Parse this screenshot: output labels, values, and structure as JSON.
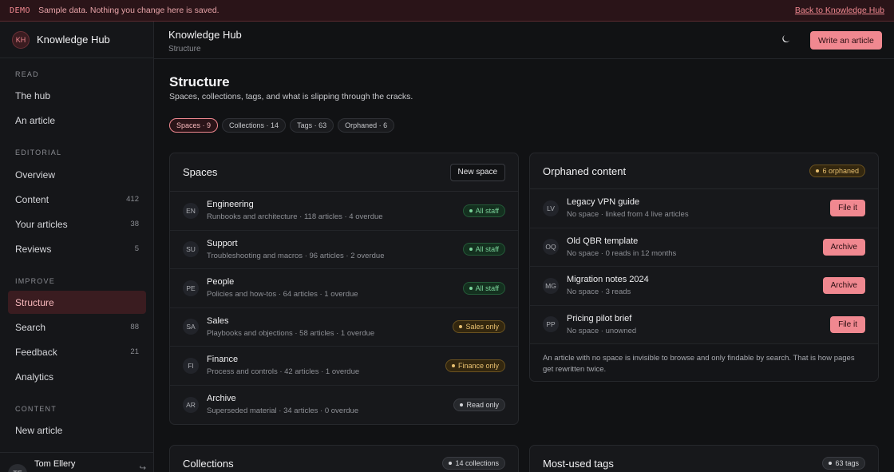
{
  "demo_bar": {
    "tag": "DEMO",
    "text": "Sample data. Nothing you change here is saved.",
    "back_link": "Back to Knowledge Hub"
  },
  "sidebar": {
    "brand_initials": "KH",
    "brand_name": "Knowledge Hub",
    "sections": {
      "read": "READ",
      "editorial": "EDITORIAL",
      "improve": "IMPROVE",
      "content": "CONTENT"
    },
    "items": {
      "the_hub": "The hub",
      "an_article": "An article",
      "overview": "Overview",
      "content": "Content",
      "content_count": "412",
      "your_articles": "Your articles",
      "your_articles_count": "38",
      "reviews": "Reviews",
      "reviews_count": "5",
      "structure": "Structure",
      "search": "Search",
      "search_count": "88",
      "feedback": "Feedback",
      "feedback_count": "21",
      "analytics": "Analytics",
      "new_article": "New article"
    },
    "user": {
      "initials": "TE",
      "name": "Tom Ellery"
    }
  },
  "topbar": {
    "title": "Knowledge Hub",
    "subtitle": "Structure",
    "theme_icon": "moon-icon",
    "write_button": "Write an article"
  },
  "page": {
    "title": "Structure",
    "subtitle": "Spaces, collections, tags, and what is slipping through the cracks."
  },
  "chips": {
    "spaces": "Spaces · 9",
    "collections": "Collections · 14",
    "tags": "Tags · 63",
    "orphaned": "Orphaned · 6"
  },
  "spaces_card": {
    "title": "Spaces",
    "new_button": "New space",
    "rows": [
      {
        "initials": "EN",
        "name": "Engineering",
        "meta": "Runbooks and architecture · 118 articles · 4 overdue",
        "badge": "All staff"
      },
      {
        "initials": "SU",
        "name": "Support",
        "meta": "Troubleshooting and macros · 96 articles · 2 overdue",
        "badge": "All staff"
      },
      {
        "initials": "PE",
        "name": "People",
        "meta": "Policies and how-tos · 64 articles · 1 overdue",
        "badge": "All staff"
      },
      {
        "initials": "SA",
        "name": "Sales",
        "meta": "Playbooks and objections · 58 articles · 1 overdue",
        "badge": "Sales only"
      },
      {
        "initials": "FI",
        "name": "Finance",
        "meta": "Process and controls · 42 articles · 1 overdue",
        "badge": "Finance only"
      },
      {
        "initials": "AR",
        "name": "Archive",
        "meta": "Superseded material · 34 articles · 0 overdue",
        "badge": "Read only"
      }
    ]
  },
  "orphaned_card": {
    "title": "Orphaned content",
    "badge": "6 orphaned",
    "rows": [
      {
        "initials": "LV",
        "name": "Legacy VPN guide",
        "meta": "No space · linked from 4 live articles",
        "action": "File it"
      },
      {
        "initials": "OQ",
        "name": "Old QBR template",
        "meta": "No space · 0 reads in 12 months",
        "action": "Archive"
      },
      {
        "initials": "MG",
        "name": "Migration notes 2024",
        "meta": "No space · 3 reads",
        "action": "Archive"
      },
      {
        "initials": "PP",
        "name": "Pricing pilot brief",
        "meta": "No space · unowned",
        "action": "File it"
      }
    ],
    "note": "An article with no space is invisible to browse and only findable by search. That is how pages get rewritten twice."
  },
  "collections_card": {
    "title": "Collections",
    "badge": "14 collections"
  },
  "tags_card": {
    "title": "Most-used tags",
    "badge": "63 tags"
  }
}
